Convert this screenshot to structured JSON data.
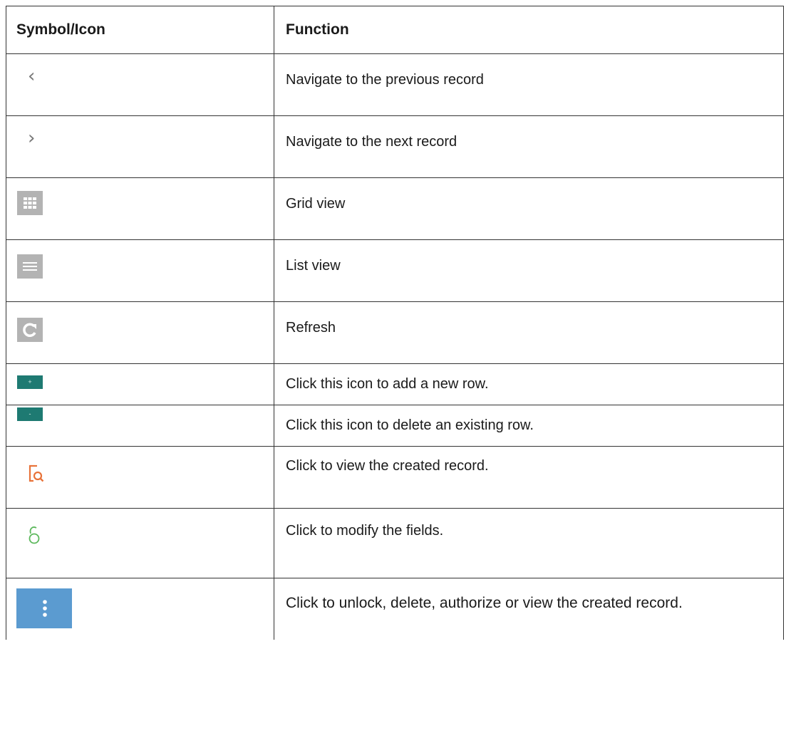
{
  "table": {
    "headers": {
      "symbol": "Symbol/Icon",
      "function": "Function"
    },
    "rows": [
      {
        "icon": "chevron-left-icon",
        "glyph": "‹",
        "text": "Navigate to the previous record"
      },
      {
        "icon": "chevron-right-icon",
        "glyph": "›",
        "text": "Navigate to the next record"
      },
      {
        "icon": "grid-view-icon",
        "text": "Grid view"
      },
      {
        "icon": "list-view-icon",
        "text": "List view"
      },
      {
        "icon": "refresh-icon",
        "text": "Refresh"
      },
      {
        "icon": "add-row-icon",
        "glyph": "+",
        "text": "Click this icon to add a new row."
      },
      {
        "icon": "delete-row-icon",
        "glyph": "-",
        "text": "Click this icon to delete an existing row."
      },
      {
        "icon": "view-record-icon",
        "text": "Click to view the created record."
      },
      {
        "icon": "unlock-modify-icon",
        "text": "Click to modify the fields."
      },
      {
        "icon": "more-options-icon",
        "text": "Click to unlock, delete, authorize or view the created record."
      }
    ]
  },
  "colors": {
    "border": "#333333",
    "icon_gray": "#b3b3b3",
    "teal": "#1e7a72",
    "orange": "#e8733a",
    "green": "#5cb85c",
    "blue": "#5b9bd0"
  }
}
